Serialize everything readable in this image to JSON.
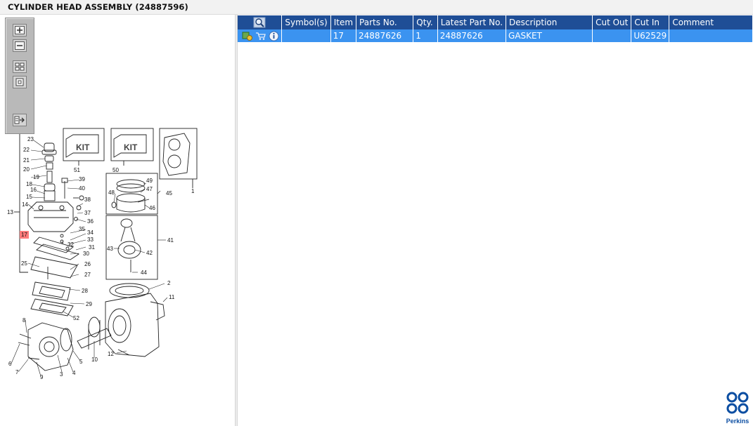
{
  "window": {
    "title": "CYLINDER HEAD ASSEMBLY (24887596)"
  },
  "toolbar": {
    "zoom_in_icon": "plus-magnifier",
    "zoom_out_icon": "minus-magnifier",
    "fit_icon": "fit-window",
    "actual_size_icon": "actual-size",
    "export_icon": "export-arrow"
  },
  "diagram": {
    "callouts": [
      "1",
      "2",
      "3",
      "4",
      "5",
      "6",
      "7",
      "8",
      "9",
      "10",
      "11",
      "12",
      "13",
      "14",
      "15",
      "16",
      "17",
      "18",
      "19",
      "20",
      "21",
      "22",
      "23",
      "25",
      "26",
      "27",
      "28",
      "29",
      "30",
      "31",
      "32",
      "33",
      "34",
      "35",
      "36",
      "37",
      "38",
      "39",
      "40",
      "41",
      "42",
      "43",
      "44",
      "45",
      "46",
      "47",
      "48",
      "49",
      "50",
      "51",
      "52"
    ],
    "kit_text": "KIT",
    "highlighted_callout": "17"
  },
  "table": {
    "headers": [
      "",
      "Symbol(s)",
      "Item",
      "Parts No.",
      "Qty.",
      "Latest Part No.",
      "Description",
      "Cut Out",
      "Cut In",
      "Comment"
    ],
    "rows": [
      {
        "symbols": "",
        "item": "17",
        "parts_no": "24887626",
        "qty": "1",
        "latest_part_no": "24887626",
        "description": "GASKET",
        "cut_out": "",
        "cut_in": "U62529",
        "comment": ""
      }
    ]
  },
  "logo": {
    "brand": "Perkins"
  },
  "colors": {
    "header": "#1f4e96",
    "selected_row": "#3b93f0",
    "highlight": "#ff7b7b",
    "brand": "#0c4ea2"
  }
}
